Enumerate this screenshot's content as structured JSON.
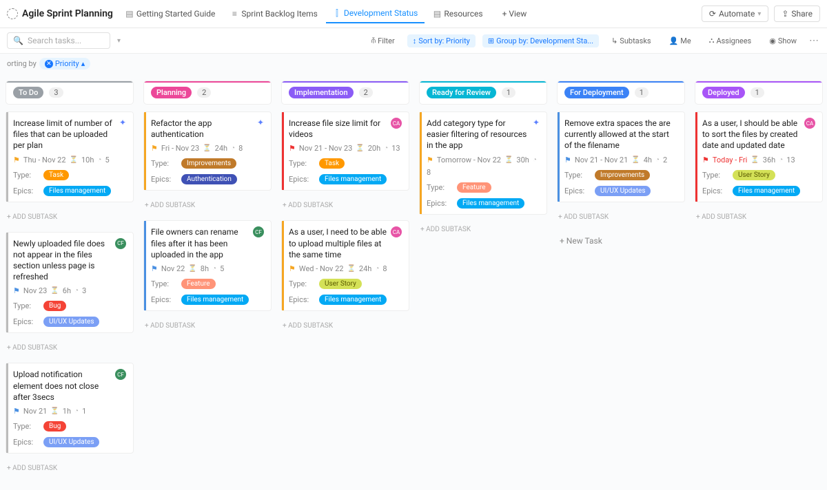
{
  "header": {
    "title": "Agile Sprint Planning",
    "tabs": [
      {
        "label": "Getting Started Guide",
        "icon": "▤"
      },
      {
        "label": "Sprint Backlog Items",
        "icon": "≡"
      },
      {
        "label": "Development Status",
        "icon": "⫿"
      },
      {
        "label": "Resources",
        "icon": "▤"
      }
    ],
    "add_view": "+ View",
    "automate": "Automate",
    "share": "Share"
  },
  "toolbar": {
    "search_placeholder": "Search tasks...",
    "filter": "Filter",
    "sort": "Sort by: Priority",
    "group": "Group by: Development Sta...",
    "subtasks": "Subtasks",
    "me": "Me",
    "assignees": "Assignees",
    "show": "Show"
  },
  "sortrow": {
    "label": "orting by",
    "value": "Priority"
  },
  "common": {
    "add_subtask": "+ ADD SUBTASK",
    "new_task": "+ New Task",
    "type_label": "Type:",
    "epics_label": "Epics:"
  },
  "columns": [
    {
      "name": "To Do",
      "count": "3",
      "pillColor": "#9aa0a6",
      "lineColor": "#9aa0a6",
      "cards": [
        {
          "title": "Increase limit of number of files that can be uploaded per plan",
          "flag": "yellow",
          "date": "Thu  -  Nov 22",
          "est": "10h",
          "sub": "5",
          "avatar": "sparkle",
          "type": "task",
          "epic": "files",
          "leftline": "#bbb"
        },
        {
          "title": "Newly uploaded file does not appear in the files section unless page is refreshed",
          "flag": "blue",
          "date": "Nov 23",
          "est": "6h",
          "sub": "3",
          "avatar": "green",
          "type": "bug",
          "epic": "uiux",
          "leftline": "#bbb"
        },
        {
          "title": "Upload notification element does not close after 3secs",
          "flag": "blue",
          "date": "Nov 21",
          "est": "1h",
          "sub": "1",
          "avatar": "green",
          "type": "bug",
          "epic": "uiux",
          "leftline": "#bbb"
        }
      ]
    },
    {
      "name": "Planning",
      "count": "2",
      "pillColor": "#ec4899",
      "lineColor": "#ec4899",
      "cards": [
        {
          "title": "Refactor the app authentication",
          "flag": "yellow",
          "date": "Fri  -  Nov 23",
          "est": "24h",
          "sub": "8",
          "avatar": "sparkle",
          "type": "improve",
          "epic": "auth",
          "leftline": "#f5a623"
        },
        {
          "title": "File owners can rename files after it has been uploaded in the app",
          "flag": "blue",
          "date": "Nov 22",
          "est": "8h",
          "sub": "5",
          "avatar": "green",
          "type": "feature",
          "epic": "files",
          "leftline": "#4a90e2"
        }
      ]
    },
    {
      "name": "Implementation",
      "count": "2",
      "pillColor": "#8b5cf6",
      "lineColor": "#8b5cf6",
      "cards": [
        {
          "title": "Increase file size limit for videos",
          "flag": "red",
          "date": "Nov 21  -  Nov 23",
          "est": "20h",
          "sub": "13",
          "avatar": "pink",
          "type": "task",
          "epic": "files",
          "leftline": "#e33"
        },
        {
          "title": "As a user, I need to be able to upload multiple files at the same time",
          "flag": "yellow",
          "date": "Wed  -  Nov 22",
          "est": "24h",
          "sub": "8",
          "avatar": "pink",
          "type": "story",
          "epic": "files",
          "leftline": "#f5a623"
        }
      ]
    },
    {
      "name": "Ready for Review",
      "count": "1",
      "pillColor": "#06b6d4",
      "lineColor": "#06b6d4",
      "cards": [
        {
          "title": "Add category type for easier filtering of resources in the app",
          "flag": "yellow",
          "date": "Tomorrow  -  Nov 22",
          "est": "30h",
          "sub": "8",
          "avatar": "sparkle",
          "type": "feature",
          "epic": "files",
          "leftline": "#f5a623"
        }
      ]
    },
    {
      "name": "For Deployment",
      "count": "1",
      "pillColor": "#3b82f6",
      "lineColor": "#3b82f6",
      "cards": [
        {
          "title": "Remove extra spaces the are currently allowed at the start of the filename",
          "flag": "blue",
          "date": "Nov 21  -  Nov 21",
          "est": "4h",
          "sub": "2",
          "avatar": "",
          "type": "improve",
          "epic": "uiux",
          "leftline": "#4a90e2"
        }
      ],
      "showNewTask": true
    },
    {
      "name": "Deployed",
      "count": "1",
      "pillColor": "#a855f7",
      "lineColor": "#a855f7",
      "cards": [
        {
          "title": "As a user, I should be able to sort the files by created date and updated date",
          "flag": "red",
          "date": "Today  -  Fri",
          "est": "36h",
          "sub": "13",
          "avatar": "pink",
          "type": "story",
          "epic": "files",
          "leftline": "#e33",
          "dateRed": true
        }
      ]
    }
  ],
  "tag_text": {
    "task": "Task",
    "bug": "Bug",
    "feature": "Feature",
    "improve": "Improvements",
    "story": "User Story",
    "files": "Files management",
    "auth": "Authentication",
    "uiux": "UI/UX Updates"
  }
}
